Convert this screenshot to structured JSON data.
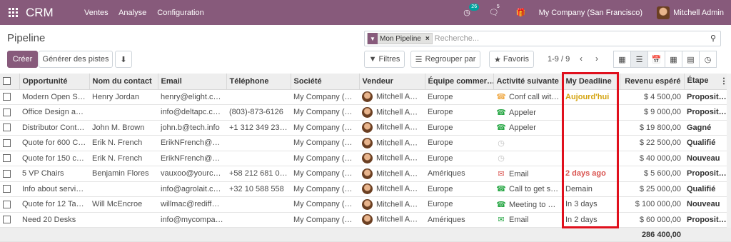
{
  "navbar": {
    "brand": "CRM",
    "menu": [
      "Ventes",
      "Analyse",
      "Configuration"
    ],
    "activity_count": "26",
    "messages_count": "5",
    "company": "My Company (San Francisco)",
    "user": "Mitchell Admin"
  },
  "control": {
    "title": "Pipeline",
    "create": "Créer",
    "generate": "Générer des pistes",
    "facet": "Mon Pipeline",
    "search_placeholder": "Recherche...",
    "filters": "Filtres",
    "groupby": "Regrouper par",
    "favorites": "Favoris",
    "pager": "1-9 / 9"
  },
  "table": {
    "headers": [
      "Opportunité",
      "Nom du contact",
      "Email",
      "Téléphone",
      "Société",
      "Vendeur",
      "Équipe commer…",
      "Activité suivante",
      "My Deadline",
      "Revenu espéré",
      "Étape"
    ],
    "rows": [
      {
        "opp": "Modern Open Sp…",
        "contact": "Henry Jordan",
        "email": "henry@elight.com",
        "phone": "",
        "company": "My Company (Sa…",
        "seller": "Mitchell Admin",
        "team": "Europe",
        "act_icon": "phone-yellow",
        "activity": "Conf call wit…",
        "deadline": "Aujourd'hui",
        "dl_style": "today",
        "revenue": "$ 4 500,00",
        "stage": "Proposition"
      },
      {
        "opp": "Office Design an…",
        "contact": "",
        "email": "info@deltapc.com",
        "phone": "(803)-873-6126",
        "company": "My Company (Sa…",
        "seller": "Mitchell Admin",
        "team": "Europe",
        "act_icon": "phone-green",
        "activity": "Appeler",
        "deadline": "",
        "dl_style": "",
        "revenue": "$ 9 000,00",
        "stage": "Proposition"
      },
      {
        "opp": "Distributor Contract",
        "contact": "John M. Brown",
        "email": "john.b@tech.info",
        "phone": "+1 312 349 2324",
        "company": "My Company (Sa…",
        "seller": "Mitchell Admin",
        "team": "Europe",
        "act_icon": "phone-green",
        "activity": "Appeler",
        "deadline": "",
        "dl_style": "",
        "revenue": "$ 19 800,00",
        "stage": "Gagné"
      },
      {
        "opp": "Quote for 600 Ch…",
        "contact": "Erik N. French",
        "email": "ErikNFrench@ar…",
        "phone": "",
        "company": "My Company (Sa…",
        "seller": "Mitchell Admin",
        "team": "Europe",
        "act_icon": "clock",
        "activity": "",
        "deadline": "",
        "dl_style": "",
        "revenue": "$ 22 500,00",
        "stage": "Qualifié"
      },
      {
        "opp": "Quote for 150 car…",
        "contact": "Erik N. French",
        "email": "ErikNFrench@ar…",
        "phone": "",
        "company": "My Company (Sa…",
        "seller": "Mitchell Admin",
        "team": "Europe",
        "act_icon": "clock",
        "activity": "",
        "deadline": "",
        "dl_style": "",
        "revenue": "$ 40 000,00",
        "stage": "Nouveau"
      },
      {
        "opp": "5 VP Chairs",
        "contact": "Benjamin Flores",
        "email": "vauxoo@yourco…",
        "phone": "+58 212 681 0538",
        "company": "My Company (Sa…",
        "seller": "Mitchell Admin",
        "team": "Amériques",
        "act_icon": "mail-red",
        "activity": "Email",
        "deadline": "2 days ago",
        "dl_style": "late",
        "revenue": "$ 5 600,00",
        "stage": "Proposition"
      },
      {
        "opp": "Info about services",
        "contact": "",
        "email": "info@agrolait.com",
        "phone": "+32 10 588 558",
        "company": "My Company (Sa…",
        "seller": "Mitchell Admin",
        "team": "Europe",
        "act_icon": "phone-green",
        "activity": "Call to get sy…",
        "deadline": "Demain",
        "dl_style": "",
        "revenue": "$ 25 000,00",
        "stage": "Qualifié"
      },
      {
        "opp": "Quote for 12 Tables",
        "contact": "Will McEncroe",
        "email": "willmac@rediffma…",
        "phone": "",
        "company": "My Company (Sa…",
        "seller": "Mitchell Admin",
        "team": "Europe",
        "act_icon": "phone-green",
        "activity": "Meeting to g…",
        "deadline": "In 3 days",
        "dl_style": "",
        "revenue": "$ 100 000,00",
        "stage": "Nouveau"
      },
      {
        "opp": "Need 20 Desks",
        "contact": "",
        "email": "info@mycompan…",
        "phone": "",
        "company": "My Company (Sa…",
        "seller": "Mitchell Admin",
        "team": "Amériques",
        "act_icon": "mail-green",
        "activity": "Email",
        "deadline": "In 2 days",
        "dl_style": "",
        "revenue": "$ 60 000,00",
        "stage": "Proposition"
      }
    ],
    "total": "286 400,00"
  },
  "colors": {
    "brand": "#875a7b",
    "highlight": "#e0101d"
  }
}
